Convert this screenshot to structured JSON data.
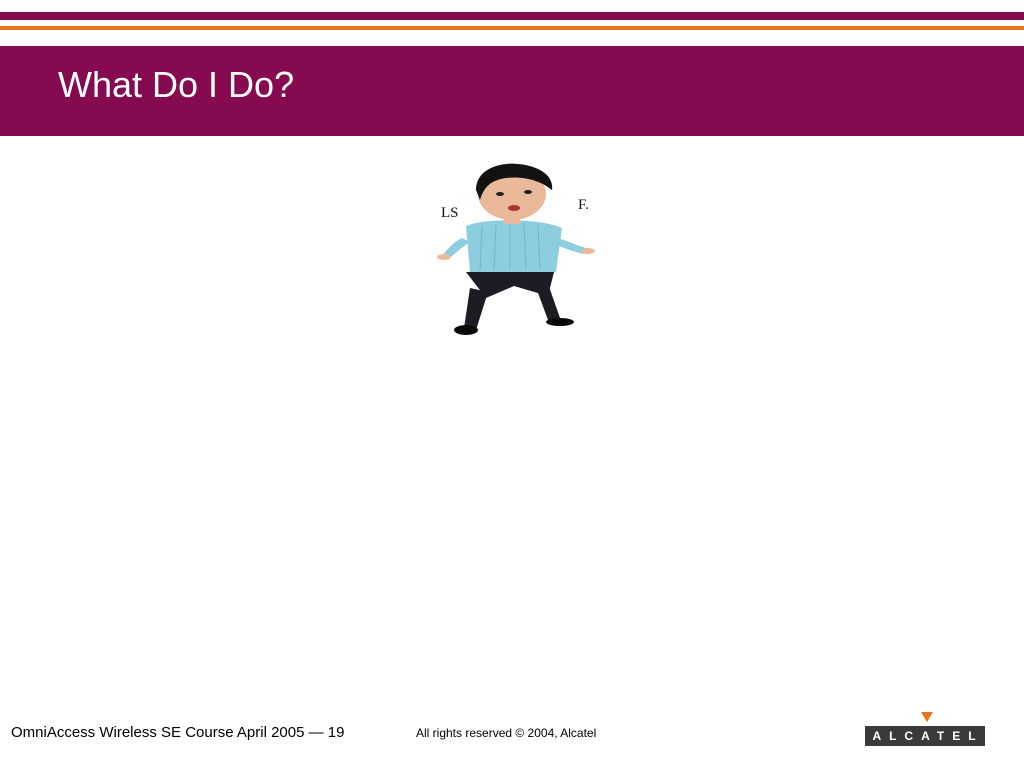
{
  "slide": {
    "title": "What Do I Do?",
    "figure": {
      "caption_left": "LS",
      "caption_right": "F.",
      "colors": {
        "skin": "#e9b99a",
        "hair": "#121212",
        "sweater": "#8ccde0",
        "pants": "#1c1c24"
      }
    }
  },
  "footer": {
    "course": "OmniAccess Wireless SE Course April 2005 — 19",
    "copyright": "All rights reserved © 2004, Alcatel",
    "logo_text": "ALCATEL"
  },
  "colors": {
    "brand_magenta": "#850a50",
    "brand_orange": "#e8751a",
    "logo_grey": "#3a3a3a"
  }
}
